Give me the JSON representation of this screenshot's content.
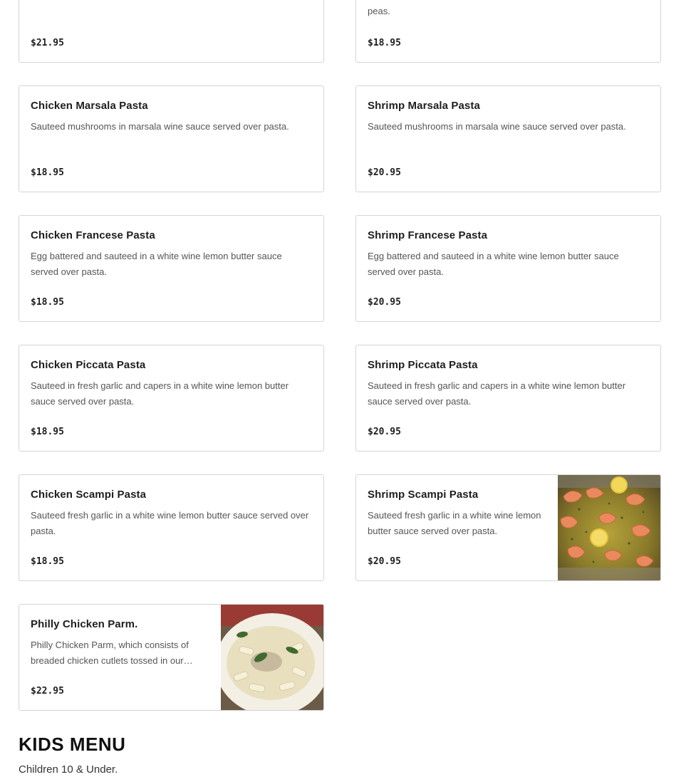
{
  "menu_items": [
    {
      "id": "partial-left",
      "name": "",
      "description": "",
      "price": "$21.95"
    },
    {
      "id": "partial-right",
      "name": "",
      "description": "peas.",
      "price": "$18.95"
    },
    {
      "id": "chicken-marsala",
      "name": "Chicken Marsala Pasta",
      "description": "Sauteed mushrooms in marsala wine sauce served over pasta.",
      "price": "$18.95"
    },
    {
      "id": "shrimp-marsala",
      "name": "Shrimp Marsala Pasta",
      "description": "Sauteed mushrooms in marsala wine sauce served over pasta.",
      "price": "$20.95"
    },
    {
      "id": "chicken-francese",
      "name": "Chicken Francese Pasta",
      "description": "Egg battered and sauteed in a white wine lemon butter sauce served over pasta.",
      "price": "$18.95"
    },
    {
      "id": "shrimp-francese",
      "name": "Shrimp Francese Pasta",
      "description": "Egg battered and sauteed in a white wine lemon butter sauce served over pasta.",
      "price": "$20.95"
    },
    {
      "id": "chicken-piccata",
      "name": "Chicken Piccata Pasta",
      "description": "Sauteed in fresh garlic and capers in a white wine lemon butter sauce served over pasta.",
      "price": "$18.95"
    },
    {
      "id": "shrimp-piccata",
      "name": "Shrimp Piccata Pasta",
      "description": "Sauteed in fresh garlic and capers in a white wine lemon butter sauce served over pasta.",
      "price": "$20.95"
    },
    {
      "id": "chicken-scampi",
      "name": "Chicken Scampi Pasta",
      "description": "Sauteed fresh garlic in a white wine lemon butter sauce served over pasta.",
      "price": "$18.95"
    },
    {
      "id": "shrimp-scampi",
      "name": "Shrimp Scampi Pasta",
      "description": "Sauteed fresh garlic in a white wine lemon butter sauce served over pasta.",
      "price": "$20.95"
    },
    {
      "id": "philly-chicken-parm",
      "name": "Philly Chicken Parm.",
      "description": "Philly Chicken Parm, which consists of breaded chicken cutlets tossed in our…",
      "price": "$22.95"
    }
  ],
  "kids_section": {
    "title": "KIDS MENU",
    "subtitle": "Children 10 & Under."
  }
}
